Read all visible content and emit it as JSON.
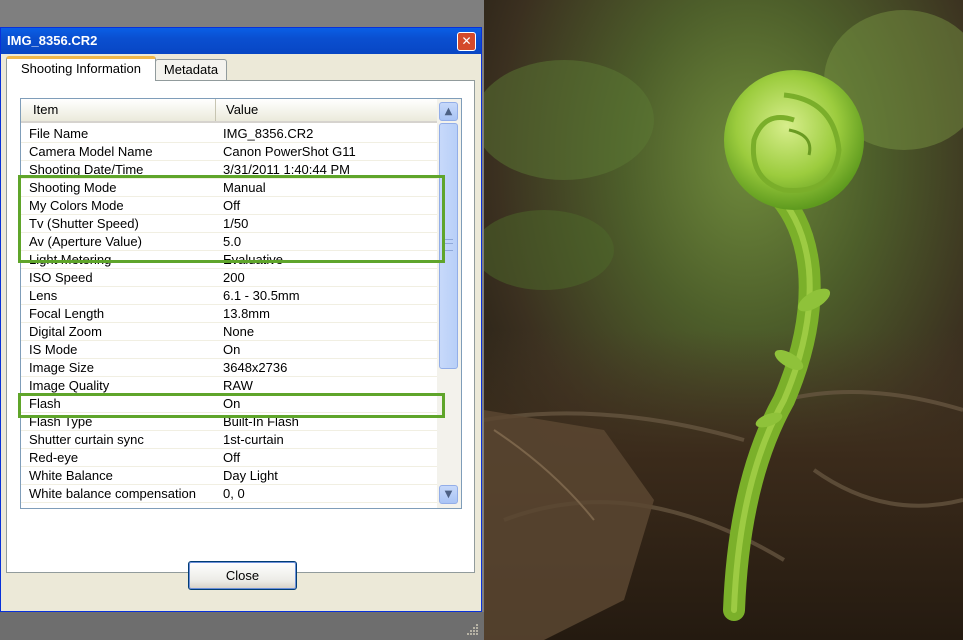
{
  "window": {
    "title": "IMG_8356.CR2",
    "close_glyph": "✕"
  },
  "tabs": [
    {
      "label": "Shooting Information",
      "selected": true
    },
    {
      "label": "Metadata",
      "selected": false
    }
  ],
  "list": {
    "columns": [
      "Item",
      "Value"
    ],
    "rows": [
      [
        "File Name",
        "IMG_8356.CR2"
      ],
      [
        "Camera Model Name",
        "Canon PowerShot G11"
      ],
      [
        "Shooting Date/Time",
        "3/31/2011 1:40:44 PM"
      ],
      [
        "Shooting Mode",
        "Manual"
      ],
      [
        "My Colors Mode",
        "Off"
      ],
      [
        "Tv (Shutter Speed)",
        "1/50"
      ],
      [
        "Av (Aperture Value)",
        "5.0"
      ],
      [
        "Light Metering",
        "Evaluative"
      ],
      [
        "ISO Speed",
        "200"
      ],
      [
        "Lens",
        "6.1 - 30.5mm"
      ],
      [
        "Focal Length",
        "13.8mm"
      ],
      [
        "Digital Zoom",
        "None"
      ],
      [
        "IS Mode",
        "On"
      ],
      [
        "Image Size",
        "3648x2736"
      ],
      [
        "Image Quality",
        "RAW"
      ],
      [
        "Flash",
        "On"
      ],
      [
        "Flash Type",
        "Built-In Flash"
      ],
      [
        "Shutter curtain sync",
        "1st-curtain"
      ],
      [
        "Red-eye",
        "Off"
      ],
      [
        "White Balance",
        "Day Light"
      ],
      [
        "White balance compensation",
        "0, 0"
      ]
    ]
  },
  "scrollbar": {
    "up_glyph": "▲",
    "down_glyph": "▼"
  },
  "close_button": {
    "label": "Close"
  },
  "colors": {
    "titlebar": "#0A4FD0",
    "highlight": "#5FA52A",
    "dialog_bg": "#ECE9D8",
    "tab_accent": "#F0B84A"
  }
}
